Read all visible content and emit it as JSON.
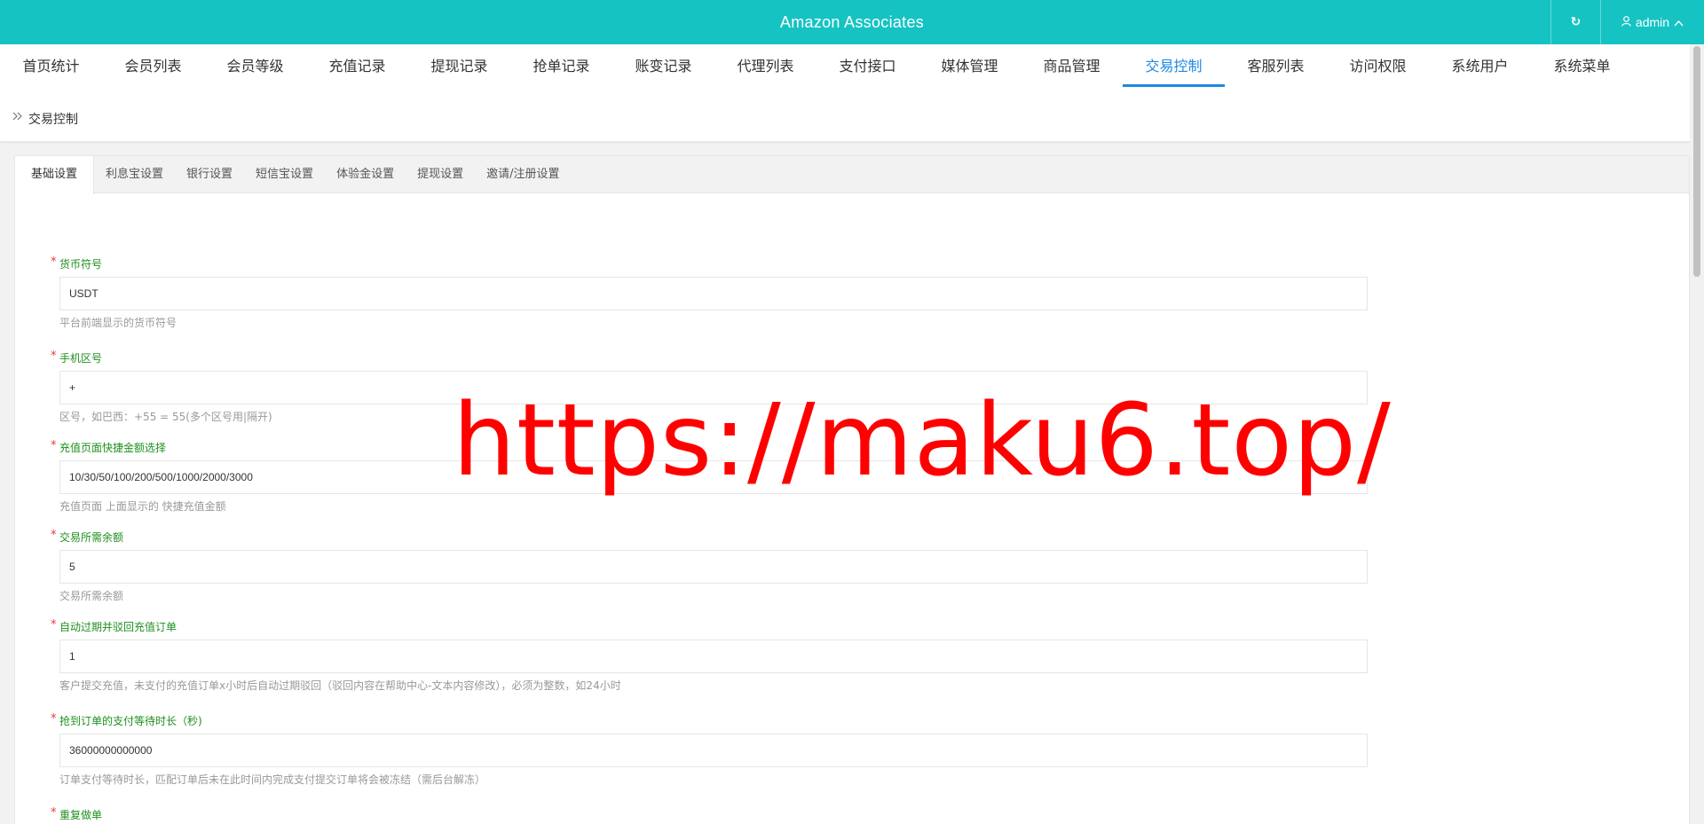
{
  "header": {
    "title": "Amazon Associates",
    "user_label": "admin"
  },
  "nav": {
    "items": [
      "首页统计",
      "会员列表",
      "会员等级",
      "充值记录",
      "提现记录",
      "抢单记录",
      "账变记录",
      "代理列表",
      "支付接口",
      "媒体管理",
      "商品管理",
      "交易控制",
      "客服列表",
      "访问权限",
      "系统用户",
      "系统菜单"
    ],
    "active": "交易控制"
  },
  "breadcrumb": {
    "text": "交易控制"
  },
  "tabs": {
    "items": [
      "基础设置",
      "利息宝设置",
      "银行设置",
      "短信宝设置",
      "体验金设置",
      "提现设置",
      "邀请/注册设置"
    ],
    "active": "基础设置"
  },
  "form": {
    "fields": [
      {
        "label": "货币符号",
        "value": "USDT",
        "help": "平台前端显示的货币符号"
      },
      {
        "label": "手机区号",
        "value": "+",
        "help": "区号，如巴西：+55 = 55(多个区号用|隔开)"
      },
      {
        "label": "充值页面快捷金额选择",
        "value": "10/30/50/100/200/500/1000/2000/3000",
        "help": "充值页面 上面显示的 快捷充值金额"
      },
      {
        "label": "交易所需余额",
        "value": "5",
        "help": "交易所需余额"
      },
      {
        "label": "自动过期并驳回充值订单",
        "value": "1",
        "help": "客户提交充值，未支付的充值订单x小时后自动过期驳回（驳回内容在帮助中心-文本内容修改），必须为整数，如24小时"
      },
      {
        "label": "抢到订单的支付等待时长（秒)",
        "value": "36000000000000",
        "help": "订单支付等待时长，匹配订单后未在此时间内完成支付提交订单将会被冻结（需后台解冻）"
      },
      {
        "label": "重复做单",
        "value": "",
        "help": ""
      }
    ]
  },
  "watermark": {
    "text": "https://maku6.top/",
    "color": "#ff0000"
  },
  "colors": {
    "topbar": "#16c3c3",
    "accent": "#1e88e5",
    "label_green": "#1f8f1f",
    "required_red": "#e53935"
  }
}
